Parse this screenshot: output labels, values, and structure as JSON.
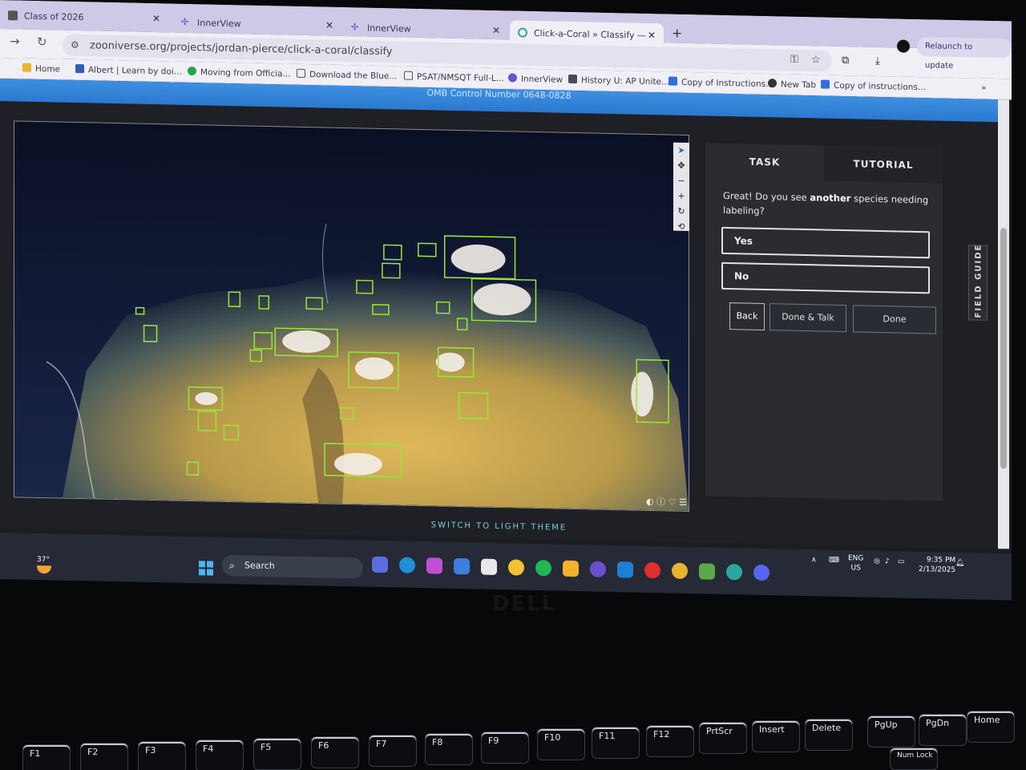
{
  "browser": {
    "tabs": [
      {
        "title": "Class of 2026",
        "active": false
      },
      {
        "title": "InnerView",
        "active": false
      },
      {
        "title": "InnerView",
        "active": false
      },
      {
        "title": "Click-a-Coral » Classify — Zoon",
        "active": true
      }
    ],
    "new_tab_label": "+",
    "url": "zooniverse.org/projects/jordan-pierce/click-a-coral/classify",
    "relaunch_label": "Relaunch to update",
    "bookmarks": [
      {
        "label": "Home",
        "color": "#e9b52a"
      },
      {
        "label": "Albert | Learn by doi...",
        "color": "#2f5fb8"
      },
      {
        "label": "Moving from Officia...",
        "color": "#25a44a"
      },
      {
        "label": "Download the Blue...",
        "color": "#555555"
      },
      {
        "label": "PSAT/NMSQT Full-L...",
        "color": "#555555"
      },
      {
        "label": "InnerView",
        "color": "#6a4fd0"
      },
      {
        "label": "History U: AP Unite...",
        "color": "#444c5c"
      },
      {
        "label": "Copy of Instructions...",
        "color": "#2f6fe0"
      },
      {
        "label": "New Tab",
        "color": "#333333"
      },
      {
        "label": "Copy of instructions...",
        "color": "#2f6fe0"
      }
    ],
    "more_bookmarks": "»"
  },
  "page": {
    "omb_notice": "OMB Control Number 0648-0828",
    "task_tab": "TASK",
    "tutorial_tab": "TUTORIAL",
    "question_pre": "Great! Do you see ",
    "question_bold": "another",
    "question_post": " species needing labeling?",
    "answers": [
      {
        "label": "Yes"
      },
      {
        "label": "No"
      }
    ],
    "back_label": "Back",
    "done_talk_label": "Done & Talk",
    "done_label": "Done",
    "field_guide_label": "FIELD GUIDE",
    "theme_switch_label": "SWITCH TO LIGHT THEME",
    "tool_icons": [
      "pointer-icon",
      "move-icon",
      "zoom-out-icon",
      "zoom-in-icon",
      "rotate-icon",
      "reset-icon"
    ],
    "accent_box_color": "#9be53a"
  },
  "taskbar": {
    "temperature": "37°",
    "search_label": "Search",
    "language": "ENG",
    "region": "US",
    "time": "9:35 PM",
    "date": "2/13/2025"
  },
  "keyboard": {
    "keys": [
      "F1",
      "F2",
      "F3",
      "F4",
      "F5",
      "F6",
      "F7",
      "F8",
      "F9",
      "F10",
      "F11",
      "F12",
      "PrtScr",
      "Insert",
      "Delete",
      "PgUp",
      "PgDn",
      "Home"
    ],
    "num_lock_label": "Num Lock"
  },
  "bezel_brand": "DELL"
}
